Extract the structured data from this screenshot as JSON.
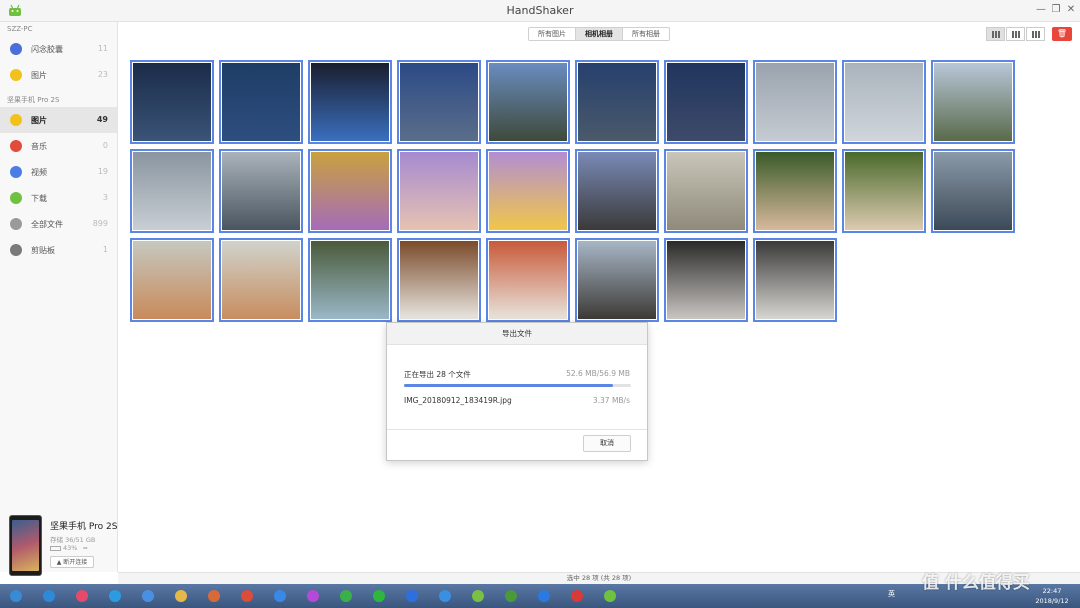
{
  "app": {
    "title": "HandShaker"
  },
  "sidebar": {
    "pc_section": "SZZ-PC",
    "pc_items": [
      {
        "label": "闪念胶囊",
        "count": "11",
        "icon": "capsule-icon",
        "color": "#4a6fd8"
      },
      {
        "label": "图片",
        "count": "23",
        "icon": "smile-icon",
        "color": "#f2c21c"
      }
    ],
    "phone_section": "坚果手机 Pro 2S",
    "phone_items": [
      {
        "label": "图片",
        "count": "49",
        "icon": "smile-icon",
        "color": "#f2c21c",
        "active": true
      },
      {
        "label": "音乐",
        "count": "0",
        "icon": "music-icon",
        "color": "#e24a3b"
      },
      {
        "label": "视频",
        "count": "19",
        "icon": "play-icon",
        "color": "#4a7ee6"
      },
      {
        "label": "下载",
        "count": "3",
        "icon": "download-icon",
        "color": "#6fc23f"
      },
      {
        "label": "全部文件",
        "count": "899",
        "icon": "all-files-icon",
        "color": "#9a9a9a"
      },
      {
        "label": "剪贴板",
        "count": "1",
        "icon": "clipboard-icon",
        "color": "#7a7a7a"
      }
    ]
  },
  "device": {
    "name": "坚果手机 Pro 2S",
    "storage": "存储 36/51 GB",
    "battery": "43%",
    "disconnect_label": "断开连接"
  },
  "toolbar": {
    "tabs": [
      {
        "label": "所有图片",
        "active": false
      },
      {
        "label": "相机相册",
        "active": true
      },
      {
        "label": "所有相册",
        "active": false
      }
    ],
    "delete_icon": "trash-icon"
  },
  "photos": [
    {
      "colors": [
        "#1b2c48",
        "#3a5378"
      ]
    },
    {
      "colors": [
        "#1e3d66",
        "#2e4e80"
      ]
    },
    {
      "colors": [
        "#1a1e2e",
        "#3a6fbf"
      ]
    },
    {
      "colors": [
        "#2c4a86",
        "#5a6e8a"
      ]
    },
    {
      "colors": [
        "#6a8cc0",
        "#3e4a3a"
      ]
    },
    {
      "colors": [
        "#26406e",
        "#4a5a6a"
      ]
    },
    {
      "colors": [
        "#20355e",
        "#3e4a6a"
      ]
    },
    {
      "colors": [
        "#9aa3ad",
        "#c5cbd2"
      ]
    },
    {
      "colors": [
        "#aab3bc",
        "#cfd5db"
      ]
    },
    {
      "colors": [
        "#b8c7d8",
        "#5a6a4a"
      ]
    },
    {
      "colors": [
        "#8a95a0",
        "#c8ced4"
      ]
    },
    {
      "colors": [
        "#aab3ba",
        "#4a5560"
      ]
    },
    {
      "colors": [
        "#c9a13e",
        "#a56cb8"
      ]
    },
    {
      "colors": [
        "#a58ad0",
        "#e7c2b2"
      ]
    },
    {
      "colors": [
        "#b28ed2",
        "#f0c64a"
      ]
    },
    {
      "colors": [
        "#7a8ab6",
        "#3a3a3a"
      ]
    },
    {
      "colors": [
        "#c9c6b9",
        "#8f8a7a"
      ]
    },
    {
      "colors": [
        "#3a5a2a",
        "#d7b99c"
      ]
    },
    {
      "colors": [
        "#4a6a2c",
        "#dccab0"
      ]
    },
    {
      "colors": [
        "#8b9aa8",
        "#3c4a58"
      ]
    },
    {
      "colors": [
        "#c5c8c0",
        "#c98a5a"
      ]
    },
    {
      "colors": [
        "#d0d3cc",
        "#c88d5f"
      ]
    },
    {
      "colors": [
        "#4a5a3a",
        "#9ab8c8"
      ]
    },
    {
      "colors": [
        "#7a4a2a",
        "#e8e6e0"
      ]
    },
    {
      "colors": [
        "#c85a3a",
        "#e8e4dc"
      ]
    },
    {
      "colors": [
        "#a7b6c6",
        "#3d3a36"
      ]
    },
    {
      "colors": [
        "#2a2a2a",
        "#c9c6c2"
      ]
    },
    {
      "colors": [
        "#3a3a3a",
        "#d8d6d2"
      ]
    }
  ],
  "dialog": {
    "title": "导出文件",
    "status": "正在导出 28 个文件",
    "size": "52.6 MB/56.9 MB",
    "progress_fraction": 0.92,
    "filename": "IMG_20180912_183419R.jpg",
    "speed": "3.37 MB/s",
    "cancel_label": "取消"
  },
  "statusbar": {
    "text": "选中 28 项 (共 28 项)"
  },
  "taskbar": {
    "apps": [
      {
        "icon": "start-icon",
        "color": "#3a8bd6"
      },
      {
        "icon": "ie-icon",
        "color": "#2e8ad8"
      },
      {
        "icon": "colorful-app-icon",
        "color": "#e54a6a"
      },
      {
        "icon": "ie-alt-icon",
        "color": "#2c9be0"
      },
      {
        "icon": "edge-icon",
        "color": "#4a90e2"
      },
      {
        "icon": "folder-icon",
        "color": "#e5b84a"
      },
      {
        "icon": "media-icon",
        "color": "#d86a3a"
      },
      {
        "icon": "chrome-icon",
        "color": "#dd4b39"
      },
      {
        "icon": "player-icon",
        "color": "#3a88e8"
      },
      {
        "icon": "color-wheel-icon",
        "color": "#b54ad8"
      },
      {
        "icon": "green-app-icon",
        "color": "#3ab04a"
      },
      {
        "icon": "iqiyi-icon",
        "color": "#2db83d"
      },
      {
        "icon": "baidu-icon",
        "color": "#2e6fe0"
      },
      {
        "icon": "bird-icon",
        "color": "#3a8fe0"
      },
      {
        "icon": "browser-icon",
        "color": "#7ac043"
      },
      {
        "icon": "paw-icon",
        "color": "#4a9a3a"
      },
      {
        "icon": "wps-icon",
        "color": "#2a7ae0"
      },
      {
        "icon": "flag-icon",
        "color": "#d83a3a"
      },
      {
        "icon": "handshaker-icon",
        "color": "#6fc23f"
      }
    ],
    "tray_text": "英",
    "time": "22:47",
    "date": "2018/9/12"
  },
  "watermark": "值 什么值得买"
}
